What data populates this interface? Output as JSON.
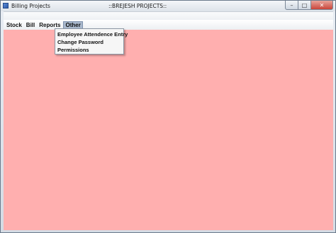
{
  "window": {
    "title": "Billing Projects",
    "center_title": "::BREJESH PROJECTS::",
    "icons": {
      "app": "app-icon",
      "minimize": "minimize-icon",
      "maximize": "maximize-icon",
      "close": "close-icon"
    }
  },
  "menubar": {
    "items": [
      {
        "label": "Stock"
      },
      {
        "label": "Bill"
      },
      {
        "label": "Reports"
      },
      {
        "label": "Other",
        "active": true
      }
    ]
  },
  "dropdown": {
    "items": [
      {
        "label": "Employee Attendence Entry"
      },
      {
        "label": "Change Password"
      },
      {
        "label": "Permissions"
      }
    ]
  },
  "colors": {
    "content_background": "#ffafaf",
    "active_menu": "#a9b8cc"
  }
}
